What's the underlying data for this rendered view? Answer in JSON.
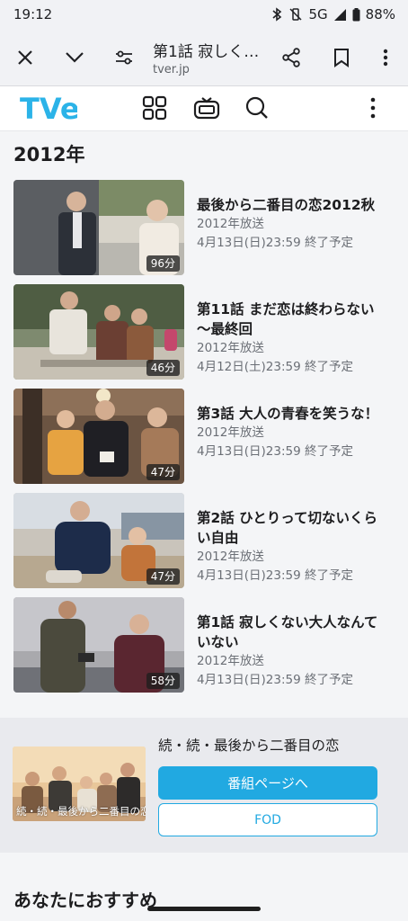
{
  "status_bar": {
    "time": "19:12",
    "network": "5G",
    "battery": "88%"
  },
  "browser": {
    "title": "第1話 寂しく…",
    "url": "tver.jp"
  },
  "tver": {
    "logo_text": "TVer"
  },
  "section": {
    "title": "2012年"
  },
  "episodes": [
    {
      "title": "最後から二番目の恋2012秋",
      "year": "2012年放送",
      "expire": "4月13日(日)23:59 終了予定",
      "duration": "96分"
    },
    {
      "title": "第11話 まだ恋は終わらない～最終回",
      "year": "2012年放送",
      "expire": "4月12日(土)23:59 終了予定",
      "duration": "46分"
    },
    {
      "title": "第3話 大人の青春を笑うな！",
      "year": "2012年放送",
      "expire": "4月13日(日)23:59 終了予定",
      "duration": "47分"
    },
    {
      "title": "第2話 ひとりって切ないくらい自由",
      "year": "2012年放送",
      "expire": "4月13日(日)23:59 終了予定",
      "duration": "47分"
    },
    {
      "title": "第1話 寂しくない大人なんていない",
      "year": "2012年放送",
      "expire": "4月13日(日)23:59 終了予定",
      "duration": "58分"
    }
  ],
  "program": {
    "title": "続・続・最後から二番目の恋",
    "thumb_caption": "続・続・最後から二番目の恋",
    "primary_button": "番組ページへ",
    "secondary_button": "FOD"
  },
  "recommend": {
    "title": "あなたにおすすめ"
  },
  "colors": {
    "accent": "#21a9e1",
    "logo": "#2bb3e8"
  }
}
